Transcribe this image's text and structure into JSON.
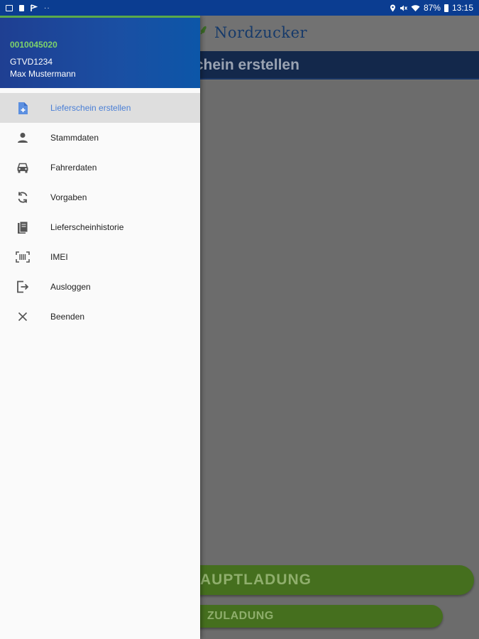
{
  "status_bar": {
    "battery": "87%",
    "time": "13:15",
    "left_icons": [
      "image-icon",
      "square-icon",
      "flag-icon",
      "dots-icon"
    ],
    "right_icons": [
      "location-icon",
      "mute-icon",
      "wifi-icon",
      "battery-icon"
    ]
  },
  "app": {
    "logo": "Nordzucker",
    "title": "Lieferschein erstellen",
    "title_visible": "rschein erstellen",
    "primary_button": "HAUPTLADUNG",
    "primary_button_visible": "AUPTLADUNG",
    "secondary_button": "ZULADUNG"
  },
  "drawer": {
    "account_number": "0010045020",
    "vehicle_code": "GTVD1234",
    "user_name": "Max Mustermann",
    "items": [
      {
        "label": "Lieferschein erstellen",
        "icon": "document-add-icon",
        "active": true
      },
      {
        "label": "Stammdaten",
        "icon": "person-icon",
        "active": false
      },
      {
        "label": "Fahrerdaten",
        "icon": "car-icon",
        "active": false
      },
      {
        "label": "Vorgaben",
        "icon": "sync-icon",
        "active": false
      },
      {
        "label": "Lieferscheinhistorie",
        "icon": "history-icon",
        "active": false
      },
      {
        "label": "IMEI",
        "icon": "barcode-icon",
        "active": false
      },
      {
        "label": "Ausloggen",
        "icon": "logout-icon",
        "active": false
      },
      {
        "label": "Beenden",
        "icon": "close-icon",
        "active": false
      }
    ]
  },
  "colors": {
    "header_blue": "#0b3d91",
    "drawer_active_text": "#4a7fd6",
    "account_green": "#7ed36a",
    "button_green": "#456f1e"
  }
}
